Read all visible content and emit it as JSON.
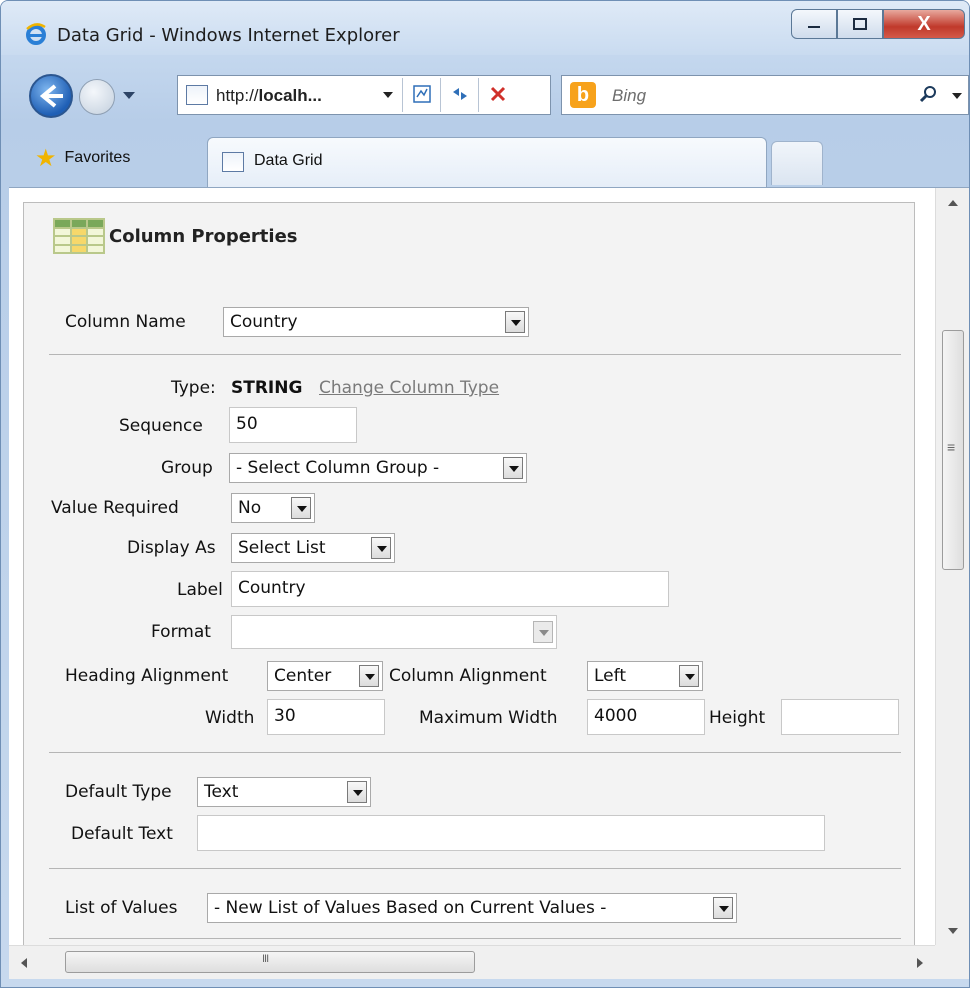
{
  "window": {
    "title": "Data Grid - Windows Internet Explorer",
    "close_glyph": "X"
  },
  "navbar": {
    "address_prefix": "http://",
    "address_host": "localh...",
    "search_placeholder": "Bing",
    "search_logo": "b"
  },
  "favbar": {
    "favorites_label": "Favorites",
    "tab_label": "Data Grid"
  },
  "panel": {
    "title": "Column Properties",
    "column_name_label": "Column Name",
    "column_name_value": "Country",
    "type_label": "Type:",
    "type_value": "STRING",
    "change_type_link": "Change Column Type",
    "sequence_label": "Sequence",
    "sequence_value": "50",
    "group_label": "Group",
    "group_value": "- Select Column Group -",
    "value_required_label": "Value Required",
    "value_required_value": "No",
    "display_as_label": "Display As",
    "display_as_value": "Select List",
    "label_label": "Label",
    "label_value": "Country",
    "format_label": "Format",
    "format_value": "",
    "heading_alignment_label": "Heading Alignment",
    "heading_alignment_value": "Center",
    "column_alignment_label": "Column Alignment",
    "column_alignment_value": "Left",
    "width_label": "Width",
    "width_value": "30",
    "max_width_label": "Maximum Width",
    "max_width_value": "4000",
    "height_label": "Height",
    "height_value": "",
    "default_type_label": "Default Type",
    "default_type_value": "Text",
    "default_text_label": "Default Text",
    "default_text_value": "",
    "lov_label": "List of Values",
    "lov_value": "- New List of Values Based on Current Values -"
  }
}
